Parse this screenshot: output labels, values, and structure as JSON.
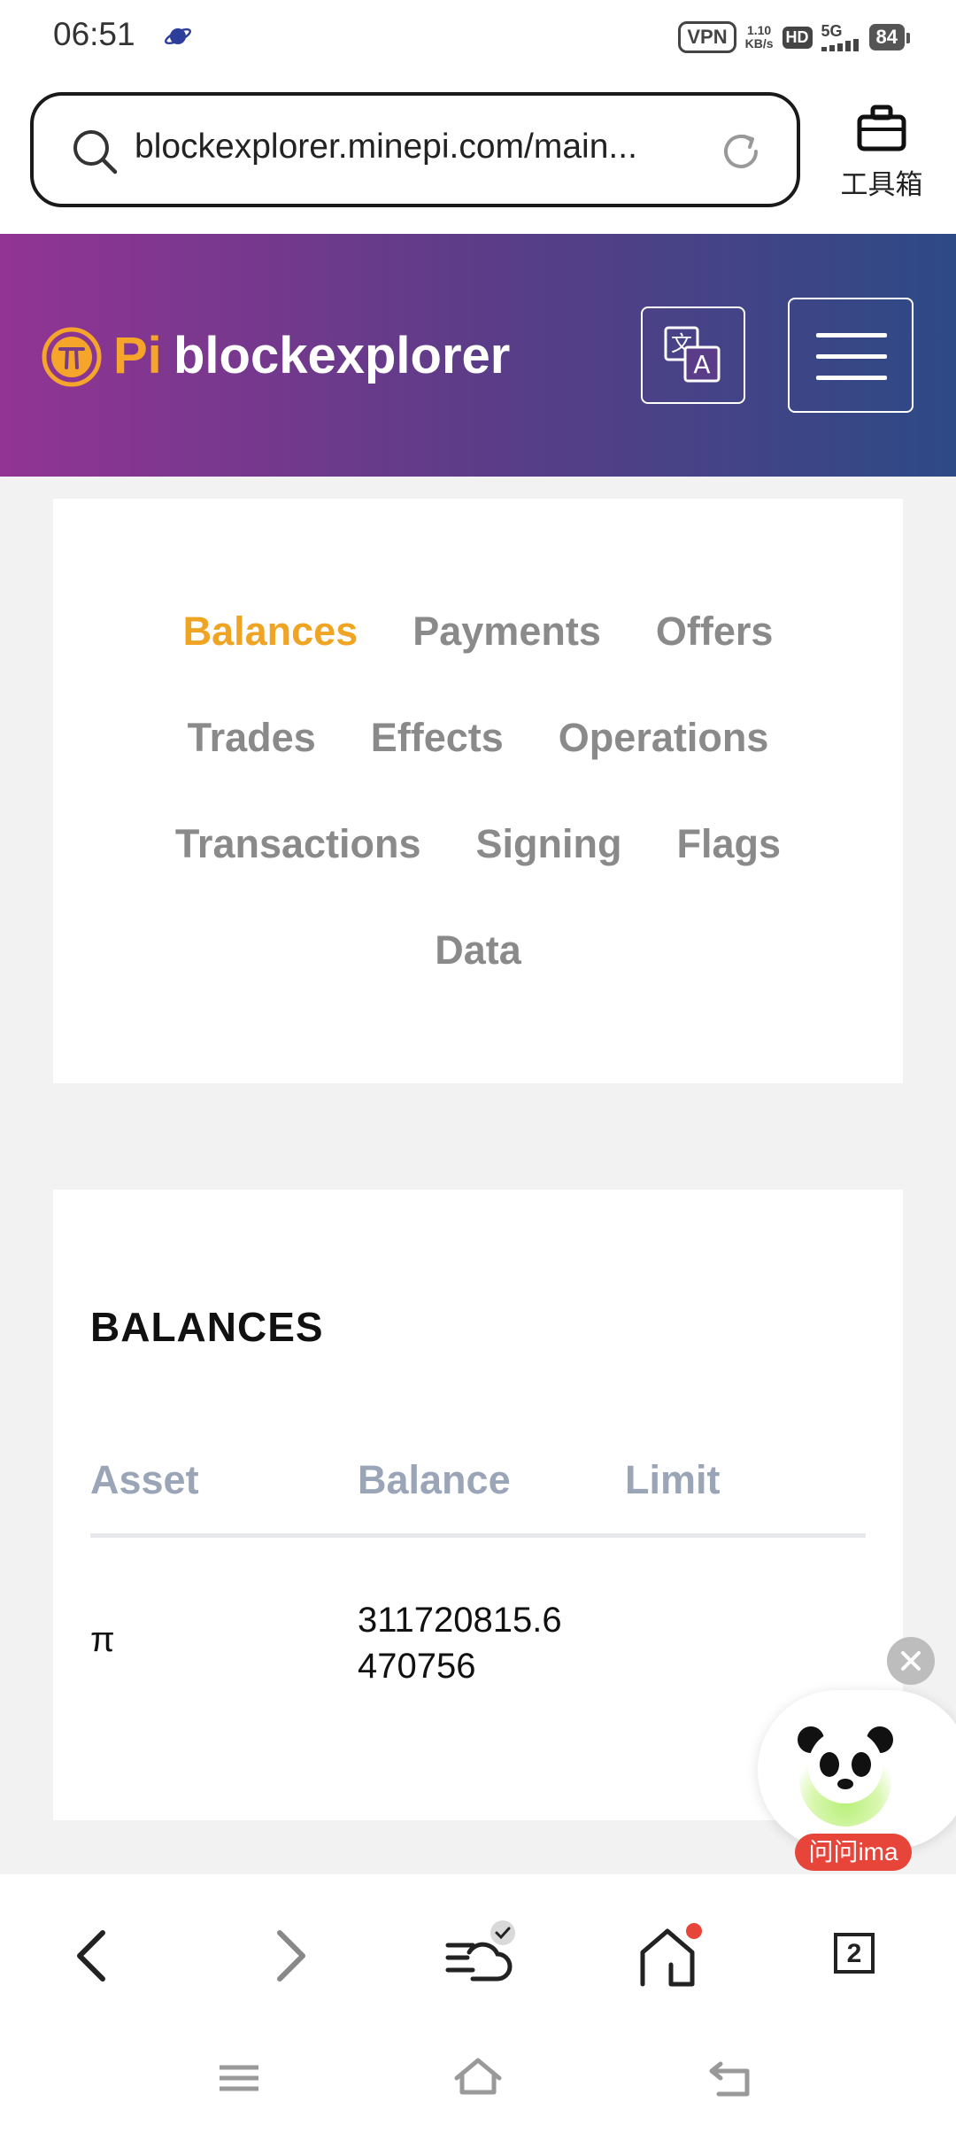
{
  "status_bar": {
    "time": "06:51",
    "vpn": "VPN",
    "speed_value": "1.10",
    "speed_unit": "KB/s",
    "hd": "HD",
    "network": "5G",
    "battery": "84"
  },
  "browser": {
    "url": "blockexplorer.minepi.com/main...",
    "toolbox_label": "工具箱",
    "tab_count": "2"
  },
  "site": {
    "logo_pi": "Pi",
    "logo_name": "blockexplorer"
  },
  "tabs": [
    {
      "label": "Balances",
      "active": true
    },
    {
      "label": "Payments"
    },
    {
      "label": "Offers"
    },
    {
      "label": "Trades"
    },
    {
      "label": "Effects"
    },
    {
      "label": "Operations"
    },
    {
      "label": "Transactions"
    },
    {
      "label": "Signing"
    },
    {
      "label": "Flags"
    },
    {
      "label": "Data"
    }
  ],
  "balances": {
    "title": "BALANCES",
    "columns": [
      "Asset",
      "Balance",
      "Limit"
    ],
    "rows": [
      {
        "asset": "π",
        "balance_line1": "311720815.6",
        "balance_line2": "470756",
        "limit": ""
      }
    ]
  },
  "ima_widget": {
    "label": "问问ima"
  },
  "colors": {
    "accent_active_tab": "#f0a424",
    "header_gradient_start": "#923494",
    "header_gradient_end": "#2d4a86",
    "table_header": "#9aa6b8"
  }
}
